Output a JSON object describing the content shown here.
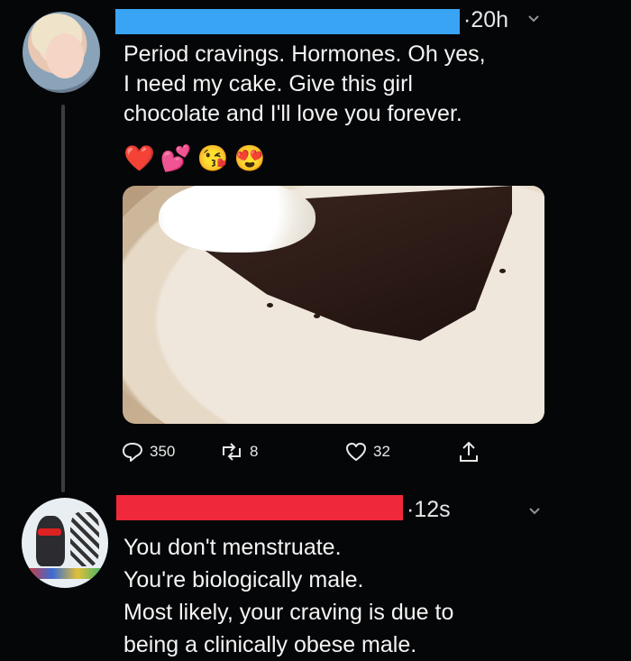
{
  "tweet": {
    "time": "20h",
    "text_lines": [
      "Period cravings. Hormones. Oh yes,",
      "I need my cake. Give this girl",
      "chocolate and I'll love you forever."
    ],
    "emojis": [
      "❤️",
      "💕",
      "😘",
      "😍"
    ],
    "actions": {
      "replies": "350",
      "retweets": "8",
      "likes": "32"
    },
    "colors": {
      "redaction": "#3aa4f4"
    }
  },
  "reply": {
    "time": "12s",
    "text_lines": [
      "You don't menstruate.",
      "You're biologically male.",
      "Most likely, your craving is due to",
      "being a clinically obese male."
    ],
    "colors": {
      "redaction": "#f0283c"
    }
  },
  "icons": [
    "reply-icon",
    "retweet-icon",
    "heart-icon",
    "share-icon",
    "chevron-down-icon"
  ],
  "colors": {
    "background": "#050608",
    "text": "#f4f4f4",
    "icon": "#e8e8e8"
  }
}
